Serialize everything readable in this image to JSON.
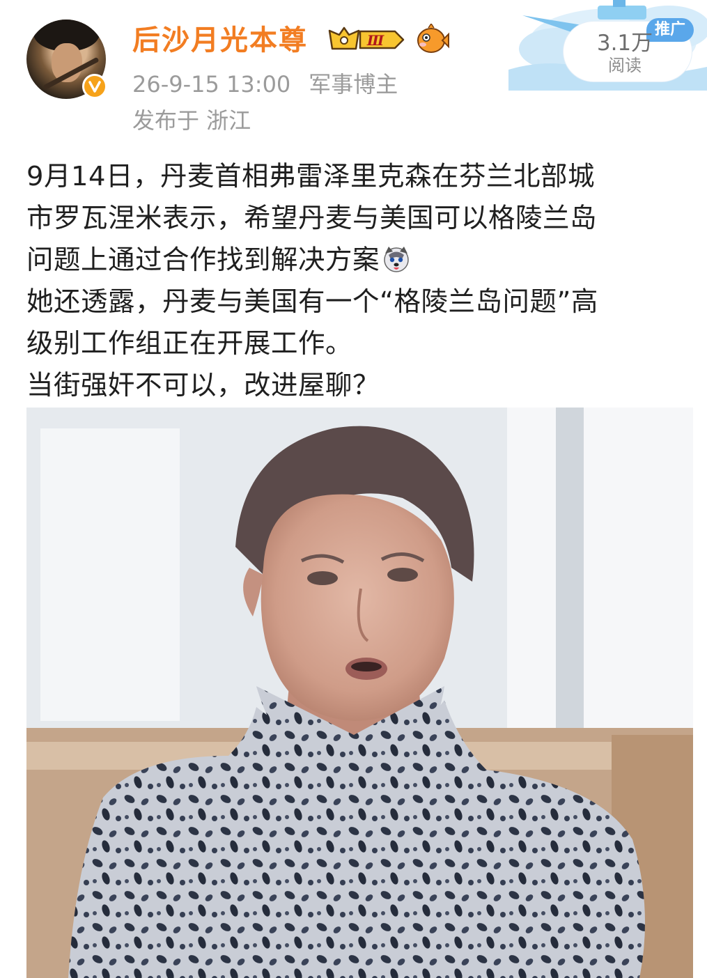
{
  "author": {
    "name": "后沙月光本尊",
    "level_badge": "Ⅲ",
    "verified_icon": "verified-v-icon",
    "fish_icon": "fish-emoji-icon"
  },
  "post_meta": {
    "datetime": "26-9-15 13:00",
    "category": "军事博主",
    "location": "发布于 浙江"
  },
  "stats": {
    "ad_tag": "推广",
    "read_count": "3.1万",
    "read_label": "阅读"
  },
  "post": {
    "lines": [
      "9月14日，丹麦首相弗雷泽里克森在芬兰北部城",
      "市罗瓦涅米表示，希望丹麦与美国可以格陵兰岛",
      "问题上通过合作找到解决方案",
      "她还透露，丹麦与美国有一个“格陵兰岛问题”高",
      "级别工作组正在开展工作。",
      "当街强奸不可以，改进屋聊？"
    ],
    "emoji": "husky-dog-emoji"
  },
  "colors": {
    "username": "#f27d22",
    "meta": "#9b9b9b",
    "text": "#1f1f1f",
    "ad_tag": "#5aa7ea"
  }
}
